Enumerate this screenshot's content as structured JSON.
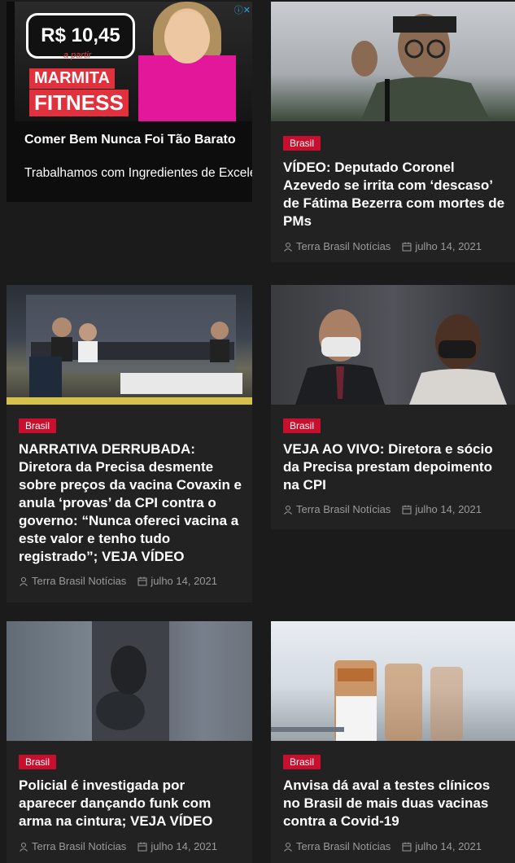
{
  "ad": {
    "price": "R$ 10,45",
    "price_sub": "a partir",
    "brand_line1": "MARMITA",
    "brand_line2": "FITNESS",
    "choices": "ⓘ✕",
    "title": "Comer Bem Nunca Foi Tão Barato",
    "description": "Trabalhamos com Ingredientes de Excelente Qualidade. Venha Conf"
  },
  "posts": [
    {
      "category": "Brasil",
      "title": "VÍDEO: Deputado Coronel Azevedo se irrita com ‘descaso’ de Fátima Bezerra com mortes de PMs",
      "author": "Terra Brasil Notícias",
      "date": "julho 14, 2021",
      "image_icon": "officer-photo"
    },
    {
      "category": "Brasil",
      "title": "NARRATIVA DERRUBADA: Diretora da Precisa desmente sobre preços da vacina Covaxin e anula ‘provas’ da CPI contra o governo: “Nunca ofereci vacina a este valor e tenho tudo registrado”; VEJA VÍDEO",
      "author": "Terra Brasil Notícias",
      "date": "julho 14, 2021",
      "image_icon": "cpi-session-photo"
    },
    {
      "category": "Brasil",
      "title": "VEJA AO VIVO: Diretora e sócio da Precisa prestam depoimento na CPI",
      "author": "Terra Brasil Notícias",
      "date": "julho 14, 2021",
      "image_icon": "testimony-photo"
    },
    {
      "category": "Brasil",
      "title": "Policial é investigada por aparecer dançando funk com arma na cintura; VEJA VÍDEO",
      "author": "Terra Brasil Notícias",
      "date": "julho 14, 2021",
      "image_icon": "blurred-photo"
    },
    {
      "category": "Brasil",
      "title": "Anvisa dá aval a testes clínicos no Brasil de mais duas vacinas contra a Covid-19",
      "author": "Terra Brasil Notícias",
      "date": "julho 14, 2021",
      "image_icon": "vaccine-vials-photo"
    }
  ],
  "colors": {
    "accent": "#c8102e",
    "background": "#1b1b1b",
    "card": "#222222",
    "meta": "#9a9a9a"
  }
}
